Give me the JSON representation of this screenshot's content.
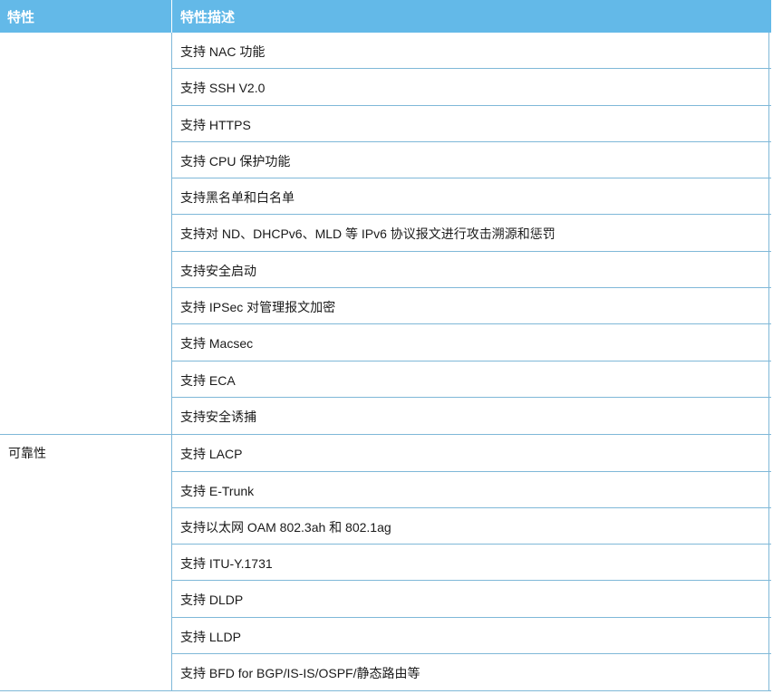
{
  "header": {
    "col1": "特性",
    "col2": "特性描述"
  },
  "groups": [
    {
      "feature": "",
      "items": [
        "支持 NAC 功能",
        "支持 SSH V2.0",
        "支持 HTTPS",
        "支持 CPU 保护功能",
        "支持黑名单和白名单",
        "支持对 ND、DHCPv6、MLD 等 IPv6 协议报文进行攻击溯源和惩罚",
        "支持安全启动",
        "支持 IPSec 对管理报文加密",
        "支持 Macsec",
        "支持 ECA",
        "支持安全诱捕"
      ]
    },
    {
      "feature": "可靠性",
      "items": [
        "支持 LACP",
        "支持 E-Trunk",
        "支持以太网 OAM 802.3ah 和 802.1ag",
        "支持 ITU-Y.1731",
        "支持 DLDP",
        "支持 LLDP",
        "支持 BFD for BGP/IS-IS/OSPF/静态路由等"
      ]
    }
  ]
}
